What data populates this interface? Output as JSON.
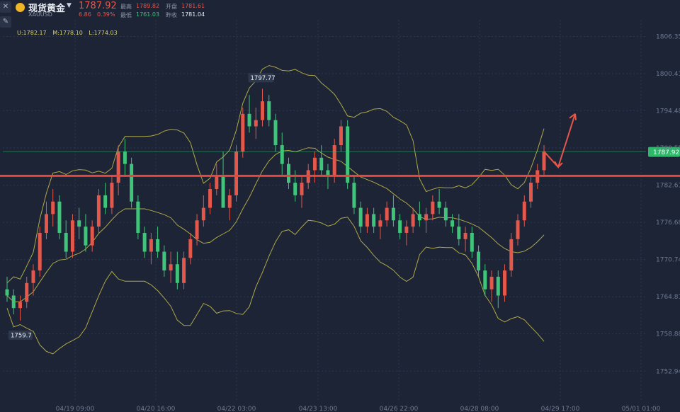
{
  "header": {
    "symbol_name": "现货黄金",
    "symbol_code": "XAUUSD",
    "last_price": "1787.92",
    "change": "6.86",
    "change_pct": "0.39%",
    "high_label": "最高",
    "high_value": "1789.82",
    "open_label": "开盘",
    "open_value": "1781.61",
    "low_label": "最低",
    "low_value": "1761.03",
    "prev_close_label": "昨收",
    "prev_close_value": "1781.04",
    "up_color": "#e4574b",
    "down_color": "#3fc47a"
  },
  "indicator": {
    "upper": "U:1782.17",
    "middle": "M:1778.10",
    "lower": "L:1774.03"
  },
  "tools": [
    {
      "icon": "close-icon",
      "glyph": "✕"
    },
    {
      "icon": "pencil-icon",
      "glyph": "✎"
    }
  ],
  "chart_data": {
    "type": "candlestick",
    "instrument": "XAUUSD",
    "y_ticks": [
      "1806.35",
      "1800.41",
      "1794.48",
      "1788.55",
      "1782.61",
      "1776.68",
      "1770.74",
      "1764.81",
      "1758.88",
      "1752.94"
    ],
    "ylim": [
      1748.0,
      1809.0
    ],
    "x_ticks": [
      "04/19 09:00",
      "04/20 16:00",
      "04/22 03:00",
      "04/23 13:00",
      "04/26 22:00",
      "04/28 08:00",
      "04/29 17:00",
      "05/01 01:00"
    ],
    "price_tag": "1787.92",
    "annotations": {
      "high_label": "1797.77",
      "low_label": "1759.7"
    },
    "support_line": 1784.1,
    "current_line": 1787.92,
    "candles": [
      [
        1766,
        1768,
        1764,
        1765
      ],
      [
        1765,
        1766,
        1762,
        1763
      ],
      [
        1763,
        1765,
        1761,
        1764
      ],
      [
        1764,
        1768,
        1763,
        1767
      ],
      [
        1767,
        1770,
        1765,
        1769
      ],
      [
        1769,
        1776,
        1768,
        1775
      ],
      [
        1775,
        1780,
        1774,
        1778
      ],
      [
        1778,
        1782,
        1776,
        1780
      ],
      [
        1780,
        1781,
        1774,
        1775
      ],
      [
        1775,
        1777,
        1771,
        1772
      ],
      [
        1772,
        1778,
        1771,
        1777
      ],
      [
        1777,
        1779,
        1774,
        1776
      ],
      [
        1776,
        1778,
        1772,
        1773
      ],
      [
        1773,
        1777,
        1772,
        1776
      ],
      [
        1776,
        1782,
        1775,
        1781
      ],
      [
        1781,
        1783,
        1778,
        1779
      ],
      [
        1779,
        1784,
        1778,
        1783
      ],
      [
        1783,
        1789,
        1781,
        1788
      ],
      [
        1788,
        1790,
        1784,
        1786
      ],
      [
        1786,
        1787,
        1779,
        1780
      ],
      [
        1780,
        1781,
        1774,
        1775
      ],
      [
        1775,
        1776,
        1771,
        1772
      ],
      [
        1772,
        1775,
        1770,
        1774
      ],
      [
        1774,
        1776,
        1771,
        1772
      ],
      [
        1772,
        1773,
        1768,
        1769
      ],
      [
        1769,
        1772,
        1767,
        1770
      ],
      [
        1770,
        1772,
        1766,
        1767
      ],
      [
        1767,
        1772,
        1766,
        1771
      ],
      [
        1771,
        1775,
        1770,
        1774
      ],
      [
        1774,
        1778,
        1773,
        1777
      ],
      [
        1777,
        1781,
        1776,
        1779
      ],
      [
        1779,
        1783,
        1778,
        1782
      ],
      [
        1782,
        1786,
        1781,
        1784
      ],
      [
        1784,
        1788,
        1782,
        1779
      ],
      [
        1779,
        1782,
        1777,
        1781
      ],
      [
        1781,
        1789,
        1780,
        1788
      ],
      [
        1788,
        1795,
        1787,
        1794
      ],
      [
        1794,
        1797,
        1791,
        1792
      ],
      [
        1792,
        1795,
        1790,
        1793
      ],
      [
        1793,
        1798,
        1792,
        1796
      ],
      [
        1796,
        1797,
        1792,
        1793
      ],
      [
        1793,
        1794,
        1788,
        1789
      ],
      [
        1789,
        1791,
        1784,
        1786
      ],
      [
        1786,
        1787,
        1782,
        1783
      ],
      [
        1783,
        1785,
        1780,
        1781
      ],
      [
        1781,
        1784,
        1779,
        1783
      ],
      [
        1783,
        1786,
        1782,
        1785
      ],
      [
        1785,
        1788,
        1783,
        1787
      ],
      [
        1787,
        1789,
        1784,
        1785
      ],
      [
        1785,
        1786,
        1782,
        1784
      ],
      [
        1784,
        1790,
        1783,
        1789
      ],
      [
        1789,
        1793,
        1788,
        1792
      ],
      [
        1792,
        1793,
        1782,
        1783
      ],
      [
        1783,
        1784,
        1778,
        1779
      ],
      [
        1779,
        1780,
        1775,
        1776
      ],
      [
        1776,
        1779,
        1775,
        1778
      ],
      [
        1778,
        1779,
        1775,
        1776
      ],
      [
        1776,
        1778,
        1774,
        1777
      ],
      [
        1777,
        1780,
        1776,
        1779
      ],
      [
        1779,
        1781,
        1776,
        1777
      ],
      [
        1777,
        1778,
        1774,
        1775
      ],
      [
        1775,
        1777,
        1773,
        1776
      ],
      [
        1776,
        1779,
        1775,
        1778
      ],
      [
        1778,
        1780,
        1776,
        1777
      ],
      [
        1777,
        1779,
        1775,
        1778
      ],
      [
        1778,
        1781,
        1777,
        1780
      ],
      [
        1780,
        1782,
        1778,
        1779
      ],
      [
        1779,
        1780,
        1776,
        1777
      ],
      [
        1777,
        1778,
        1775,
        1776
      ],
      [
        1776,
        1778,
        1773,
        1774
      ],
      [
        1774,
        1776,
        1772,
        1775
      ],
      [
        1775,
        1776,
        1771,
        1772
      ],
      [
        1772,
        1773,
        1768,
        1769
      ],
      [
        1769,
        1770,
        1765,
        1766
      ],
      [
        1766,
        1769,
        1764,
        1768
      ],
      [
        1768,
        1769,
        1763,
        1765
      ],
      [
        1765,
        1770,
        1764,
        1769
      ],
      [
        1769,
        1775,
        1768,
        1774
      ],
      [
        1774,
        1778,
        1773,
        1777
      ],
      [
        1777,
        1781,
        1776,
        1780
      ],
      [
        1780,
        1784,
        1779,
        1783
      ],
      [
        1783,
        1786,
        1782,
        1785
      ],
      [
        1785,
        1789,
        1784,
        1788
      ]
    ]
  }
}
